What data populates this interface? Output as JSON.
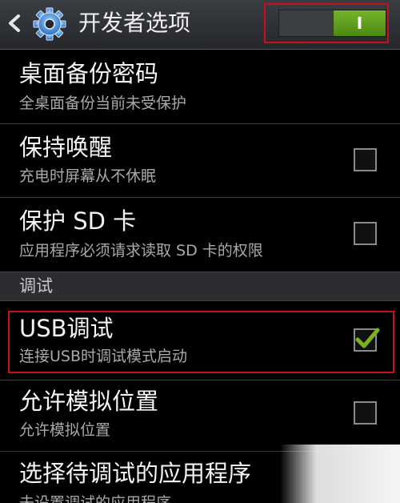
{
  "header": {
    "back_icon": "chevron-left-icon",
    "settings_icon": "gear-icon",
    "title": "开发者选项",
    "toggle_label": "I",
    "toggle_state": "on",
    "toggle_color": "#5b9c1d",
    "highlight_color": "#c4121a"
  },
  "items": [
    {
      "title": "桌面备份密码",
      "subtitle": "全桌面备份当前未受保护",
      "has_checkbox": false
    },
    {
      "title": "保持唤醒",
      "subtitle": "充电时屏幕从不休眠",
      "has_checkbox": true,
      "checked": false
    },
    {
      "title": "保护 SD 卡",
      "subtitle": "应用程序必须请求读取 SD 卡的权限",
      "has_checkbox": true,
      "checked": false
    }
  ],
  "section": {
    "label": "调试"
  },
  "debug_items": [
    {
      "title": "USB调试",
      "subtitle": "连接USB时调试模式启动",
      "has_checkbox": true,
      "checked": true,
      "check_color": "#7ab51d"
    },
    {
      "title": "允许模拟位置",
      "subtitle": "允许模拟位置",
      "has_checkbox": true,
      "checked": false
    },
    {
      "title": "选择待调试的应用程序",
      "subtitle": "未设置调试的应用程序",
      "has_checkbox": false
    }
  ]
}
